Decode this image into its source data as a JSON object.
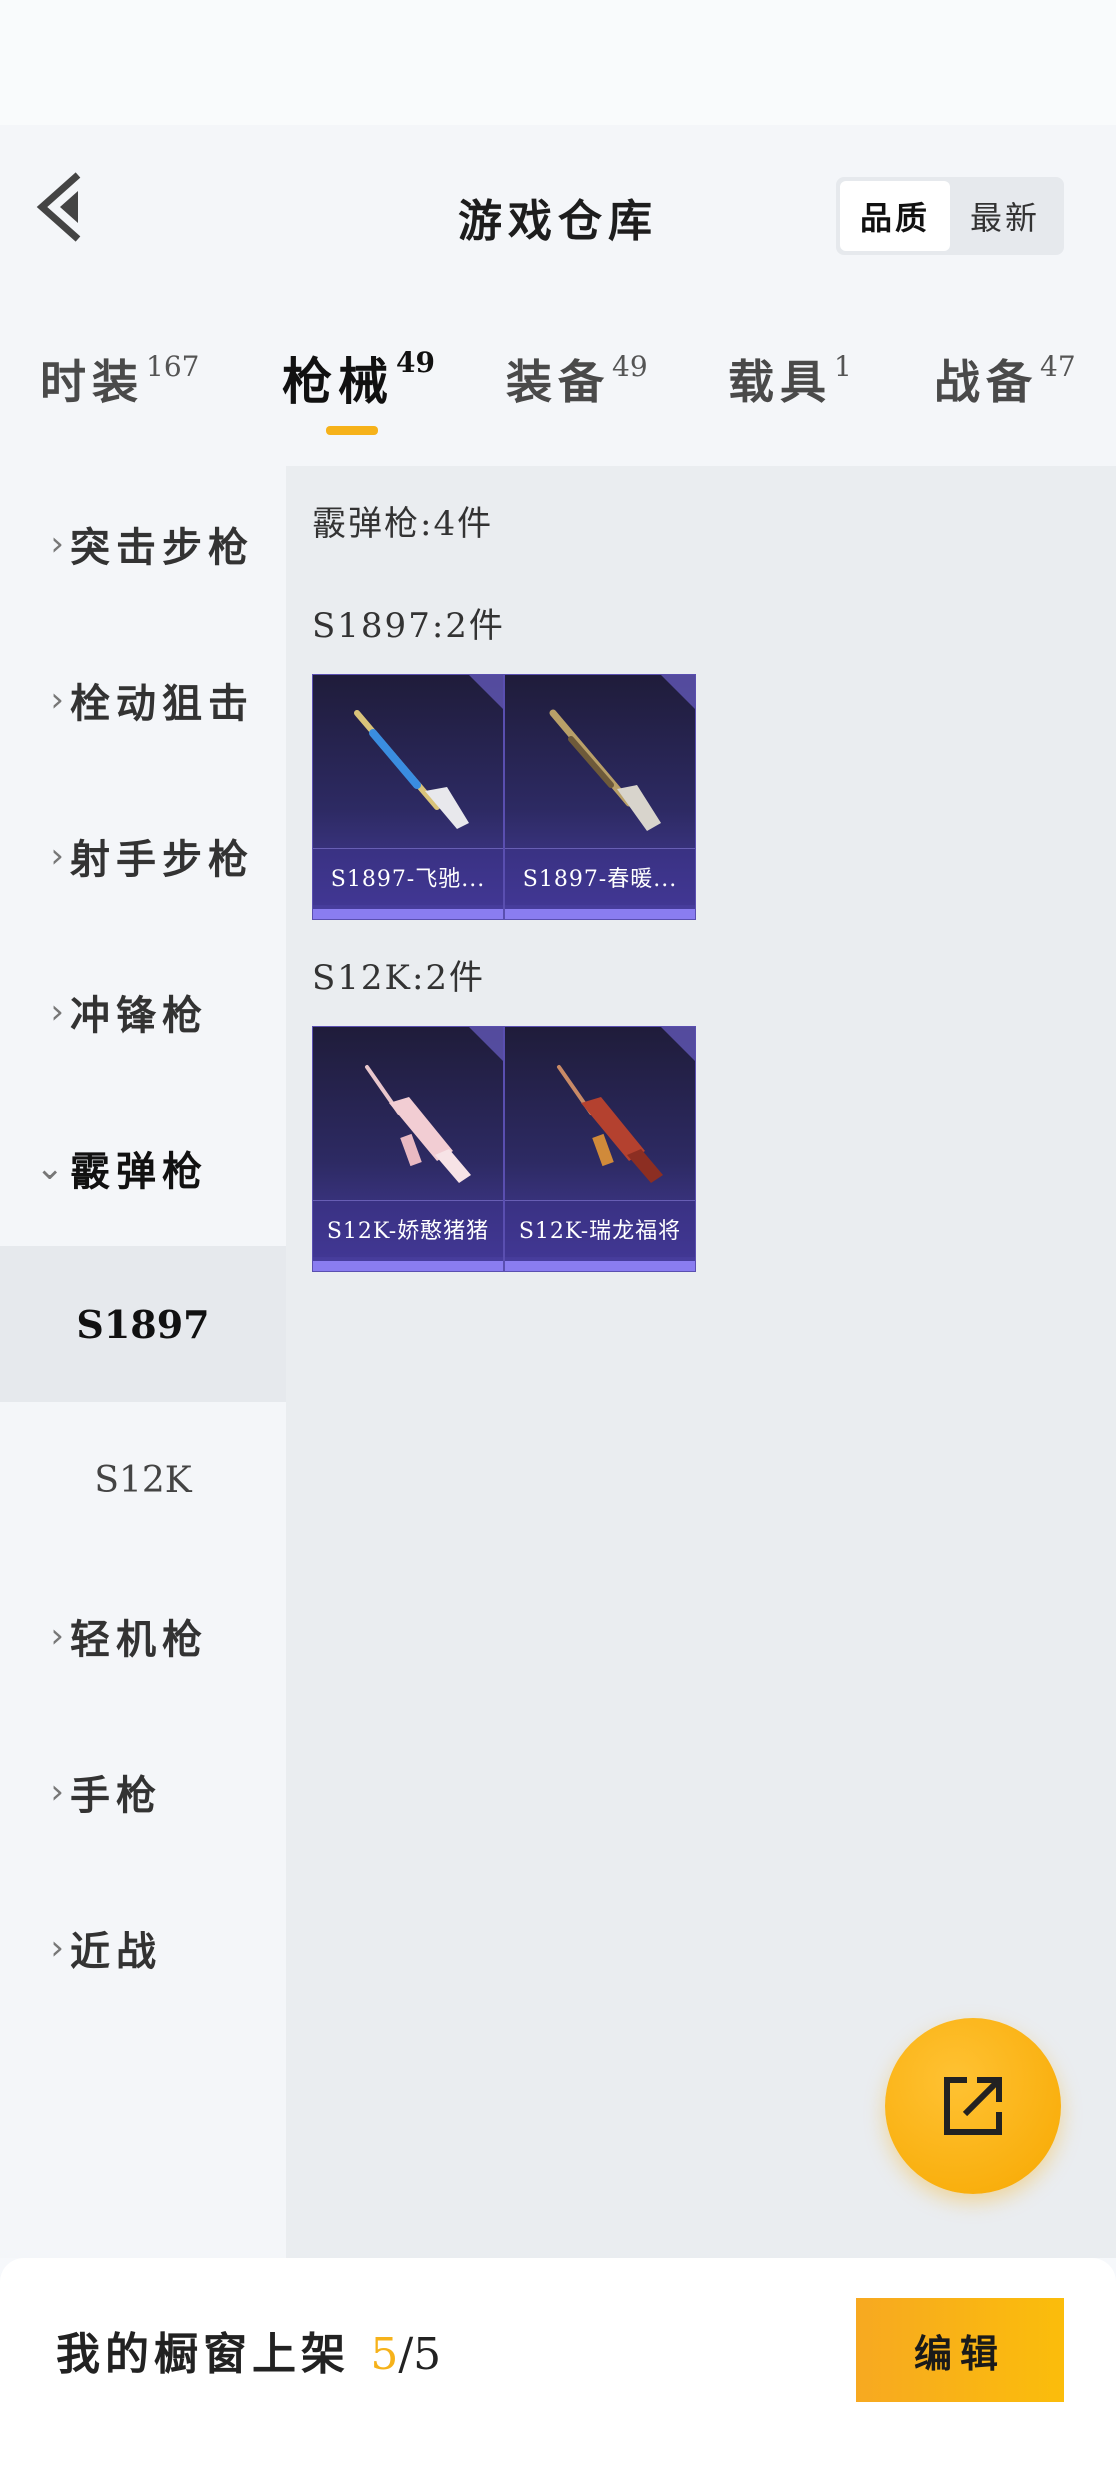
{
  "header": {
    "title": "游戏仓库",
    "sort_options": [
      "品质",
      "最新"
    ],
    "sort_selected": "品质"
  },
  "tabs": [
    {
      "label": "时装",
      "count": "167"
    },
    {
      "label": "枪械",
      "count": "49"
    },
    {
      "label": "装备",
      "count": "49"
    },
    {
      "label": "载具",
      "count": "1"
    },
    {
      "label": "战备",
      "count": "47"
    }
  ],
  "active_tab": "枪械",
  "sidebar": {
    "items": [
      {
        "label": "突击步枪"
      },
      {
        "label": "栓动狙击"
      },
      {
        "label": "射手步枪"
      },
      {
        "label": "冲锋枪"
      },
      {
        "label": "霰弹枪"
      },
      {
        "label": "轻机枪"
      },
      {
        "label": "手枪"
      },
      {
        "label": "近战"
      }
    ],
    "subitems": [
      "S1897",
      "S12K"
    ],
    "selected_sub": "S1897"
  },
  "content": {
    "category_title": "霰弹枪:4件",
    "groups": [
      {
        "title": "S1897:2件",
        "items": [
          "S1897-飞驰...",
          "S1897-春暖..."
        ]
      },
      {
        "title": "S12K:2件",
        "items": [
          "S12K-娇憨猪猪",
          "S12K-瑞龙福将"
        ]
      }
    ]
  },
  "bottom": {
    "showcase_label": "我的橱窗上架",
    "showcase_count": "5",
    "showcase_total": "/5",
    "edit_label": "编辑"
  },
  "colors": {
    "accent": "#f6b21a",
    "card_bg": "#2d2a63",
    "card_bar": "#8a7df0"
  }
}
